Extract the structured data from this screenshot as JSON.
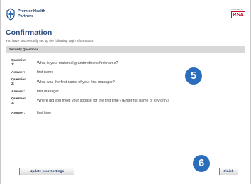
{
  "brand": {
    "logo_line1": "Premier Health",
    "logo_line2": "Partners",
    "rsa_small": "SECURED BY",
    "rsa": "RSA"
  },
  "page": {
    "title": "Confirmation",
    "subtitle": "You have successfully set up the following login information:",
    "section_title": "Security Questions"
  },
  "qa": [
    {
      "q_label": "Question 1:",
      "question": "What is your maternal grandmother's first name?",
      "a_label": "Answer:",
      "answer": "first name"
    },
    {
      "q_label": "Question 2:",
      "question": "What was the first name of your first manager?",
      "a_label": "Answer:",
      "answer": "first manager"
    },
    {
      "q_label": "Question 3:",
      "question": "Where did you meet your spouse for the first time? (Enter full name of city only)",
      "a_label": "Answer:",
      "answer": "first time"
    }
  ],
  "badges": {
    "five": "5",
    "six": "6"
  },
  "buttons": {
    "update": "Update your Settings",
    "finish": "Finish"
  },
  "colors": {
    "accent_blue": "#2a6ebb",
    "title_blue": "#2c4a7c",
    "rsa_red": "#c8102e"
  }
}
